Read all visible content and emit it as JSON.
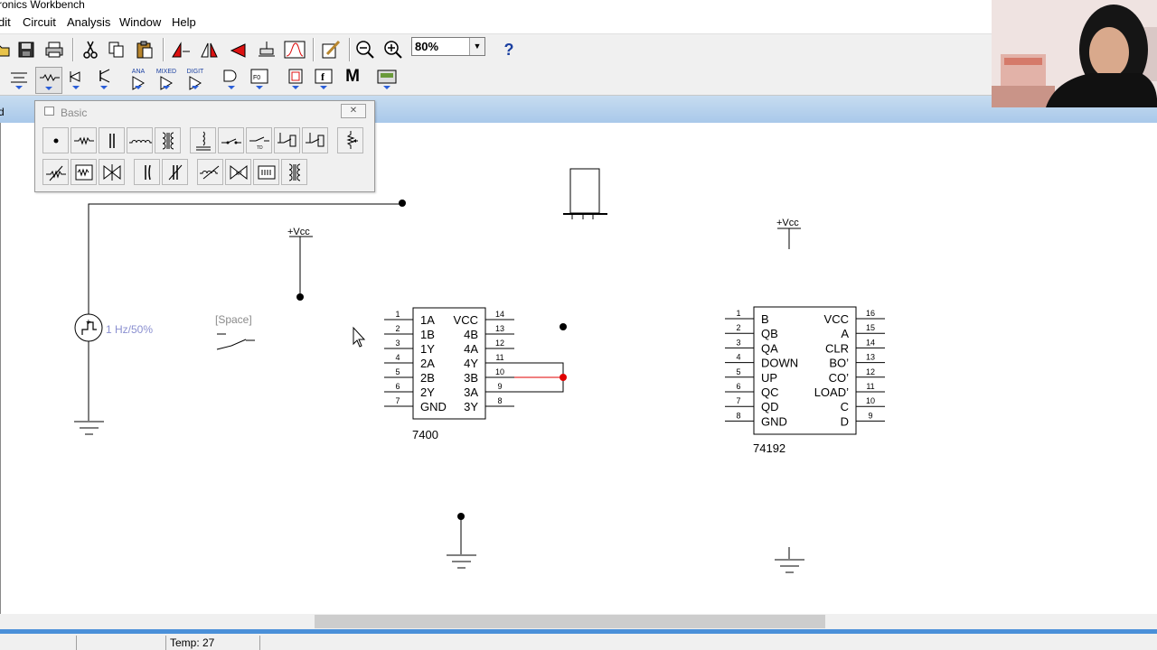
{
  "window": {
    "title": "ronics Workbench"
  },
  "menu": {
    "items": [
      "dit",
      "Circuit",
      "Analysis",
      "Window",
      "Help"
    ]
  },
  "toolbar": {
    "zoom_value": "80%",
    "help_label": "?",
    "instrument_m": "M",
    "logic_f": "f",
    "ana_label": "ANA",
    "mixed_label": "MIXED",
    "digit_label": "DIGIT"
  },
  "document": {
    "tab_label": "d"
  },
  "palette": {
    "title": "Basic"
  },
  "circuit": {
    "clock_label": "1 Hz/50%",
    "switch_label": "[Space]",
    "vcc_label_1": "+Vcc",
    "vcc_label_2": "+Vcc",
    "chip1": {
      "name": "7400",
      "left_pins": [
        {
          "num": "1",
          "label": "1A"
        },
        {
          "num": "2",
          "label": "1B"
        },
        {
          "num": "3",
          "label": "1Y"
        },
        {
          "num": "4",
          "label": "2A"
        },
        {
          "num": "5",
          "label": "2B"
        },
        {
          "num": "6",
          "label": "2Y"
        },
        {
          "num": "7",
          "label": "GND"
        }
      ],
      "right_pins": [
        {
          "num": "14",
          "label": "VCC"
        },
        {
          "num": "13",
          "label": "4B"
        },
        {
          "num": "12",
          "label": "4A"
        },
        {
          "num": "11",
          "label": "4Y"
        },
        {
          "num": "10",
          "label": "3B"
        },
        {
          "num": "9",
          "label": "3A"
        },
        {
          "num": "8",
          "label": "3Y"
        }
      ]
    },
    "chip2": {
      "name": "74192",
      "left_pins": [
        {
          "num": "1",
          "label": "B"
        },
        {
          "num": "2",
          "label": "QB"
        },
        {
          "num": "3",
          "label": "QA"
        },
        {
          "num": "4",
          "label": "DOWN"
        },
        {
          "num": "5",
          "label": "UP"
        },
        {
          "num": "6",
          "label": "QC"
        },
        {
          "num": "7",
          "label": "QD"
        },
        {
          "num": "8",
          "label": "GND"
        }
      ],
      "right_pins": [
        {
          "num": "16",
          "label": "VCC"
        },
        {
          "num": "15",
          "label": "A"
        },
        {
          "num": "14",
          "label": "CLR"
        },
        {
          "num": "13",
          "label": "BO’"
        },
        {
          "num": "12",
          "label": "CO’"
        },
        {
          "num": "11",
          "label": "LOAD’"
        },
        {
          "num": "10",
          "label": "C"
        },
        {
          "num": "9",
          "label": "D"
        }
      ]
    }
  },
  "status": {
    "temp": "Temp:  27"
  },
  "colors": {
    "header_blue": "#a9c8ea",
    "status_blue": "#4a90d9",
    "junction_red": "#e00000"
  }
}
